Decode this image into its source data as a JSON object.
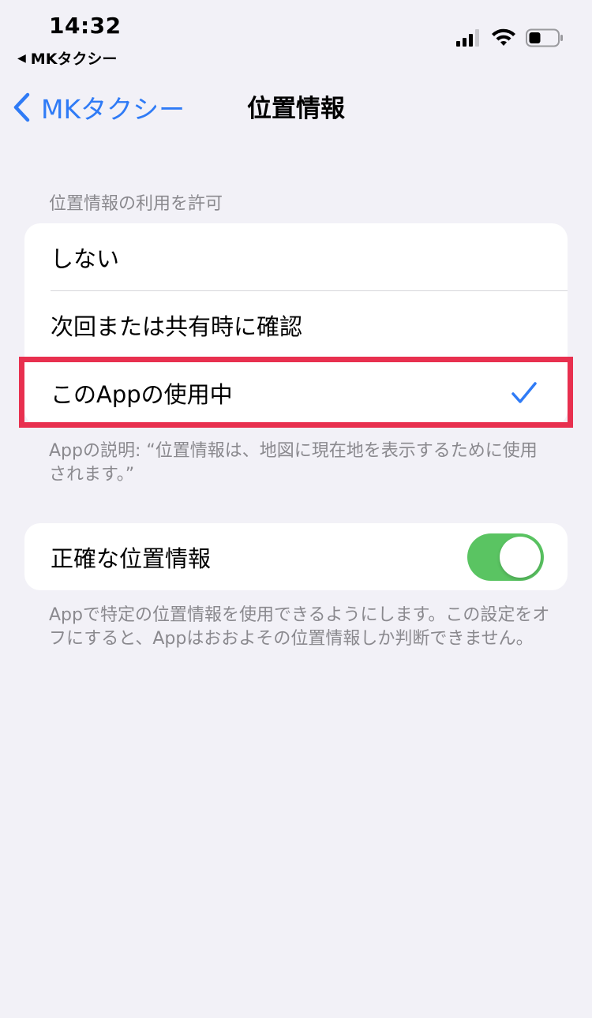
{
  "status_bar": {
    "time": "14:32",
    "back_app": "MKタクシー",
    "back_arrow": "◀"
  },
  "nav": {
    "back_label": "MKタクシー",
    "title": "位置情報"
  },
  "location_access": {
    "header": "位置情報の利用を許可",
    "options": [
      {
        "label": "しない",
        "selected": false
      },
      {
        "label": "次回または共有時に確認",
        "selected": false
      },
      {
        "label": "このAppの使用中",
        "selected": true
      }
    ],
    "app_description": "Appの説明: “位置情報は、地図に現在地を表示するために使用されます。”"
  },
  "precise_location": {
    "label": "正確な位置情報",
    "enabled": true,
    "description": "Appで特定の位置情報を使用できるようにします。この設定をオフにすると、Appはおおよその位置情報しか判断できません。"
  },
  "colors": {
    "accent": "#2f7bf6",
    "toggle_on": "#5ac462",
    "highlight": "#e8304f",
    "background": "#f2f1f7"
  }
}
